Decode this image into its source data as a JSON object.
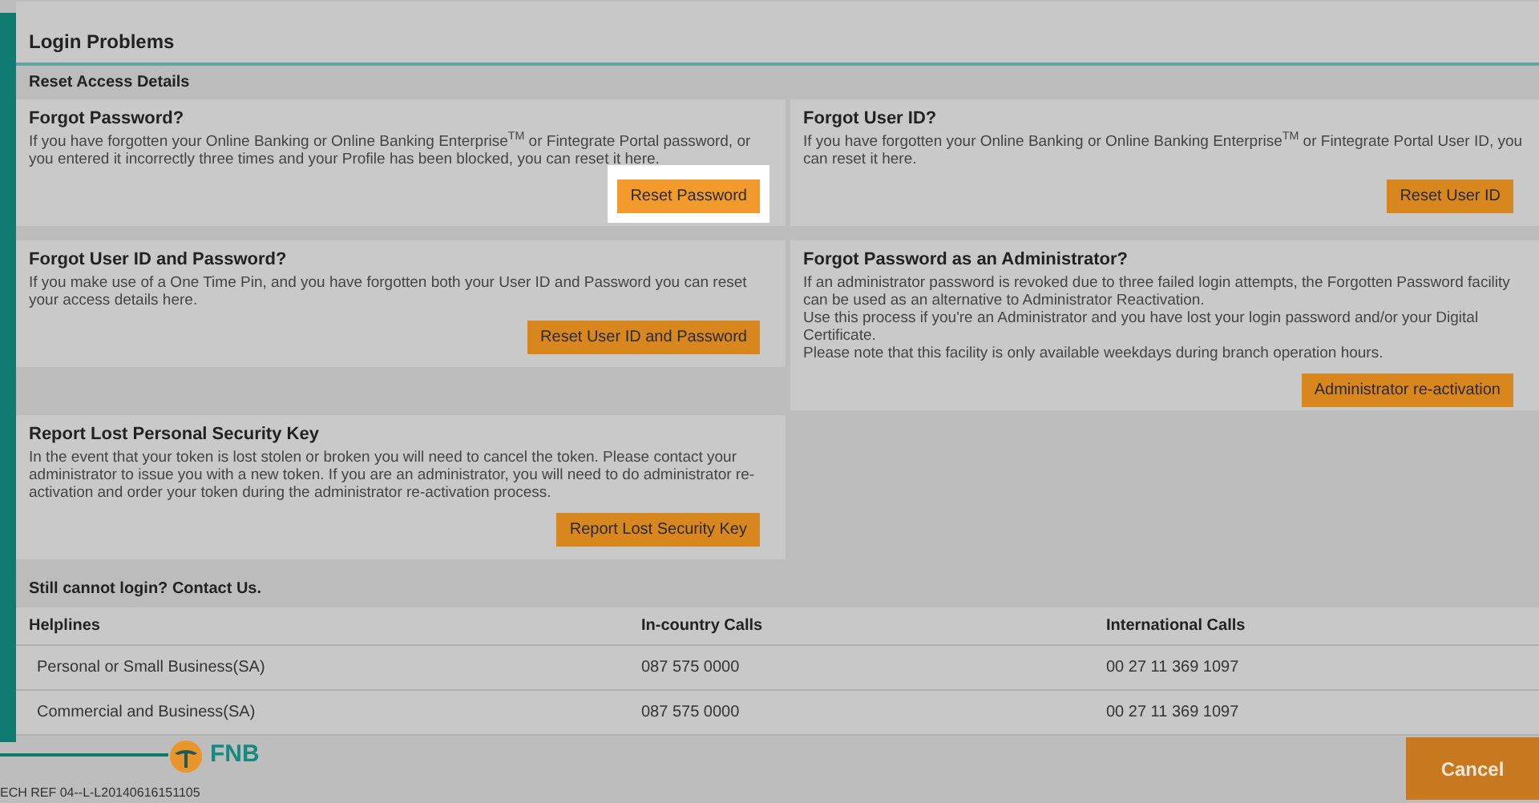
{
  "title": "Login Problems",
  "section": "Reset Access Details",
  "cards": [
    {
      "heading": "Forgot Password?",
      "body": [
        "If you have forgotten your Online Banking or Online Banking Enterprise$^{TM}$ or Fintegrate Portal password, or you entered it incorrectly three times and your Profile has been blocked, you can reset it here."
      ],
      "button": "Reset Password",
      "highlighted": true
    },
    {
      "heading": "Forgot User ID?",
      "body": [
        "If you have forgotten your Online Banking or Online Banking Enterprise$^{TM}$ or Fintegrate Portal User ID, you can reset it here."
      ],
      "button": "Reset User ID",
      "highlighted": false
    },
    {
      "heading": "Forgot User ID and Password?",
      "body": [
        "If you make use of a One Time Pin, and you have forgotten both your User ID and Password you can reset your access details here."
      ],
      "button": "Reset User ID and Password",
      "highlighted": false
    },
    {
      "heading": "Forgot Password as an Administrator?",
      "body": [
        "If an administrator password is revoked due to three failed login attempts, the Forgotten Password facility can be used as an alternative to Administrator Reactivation.",
        "Use this process if you're an Administrator and you have lost your login password and/or your Digital Certificate.",
        "Please note that this facility is only available weekdays during branch operation hours."
      ],
      "button": "Administrator re-activation",
      "highlighted": false
    },
    {
      "heading": "Report Lost Personal Security Key",
      "body": [
        "In the event that your token is lost stolen or broken you will need to cancel the token. Please contact your administrator to issue you with a new token. If you are an administrator, you will need to do administrator re-activation and order your token during the administrator re-activation process."
      ],
      "button": "Report Lost Security Key",
      "highlighted": false
    }
  ],
  "contact": {
    "heading": "Still cannot login? Contact Us.",
    "columns": [
      "Helplines",
      "In-country Calls",
      "International Calls"
    ],
    "rows": [
      [
        "Personal or Small Business(SA)",
        "087 575 0000",
        "00 27 11 369 1097"
      ],
      [
        "Commercial and Business(SA)",
        "087 575 0000",
        "00 27 11 369 1097"
      ]
    ]
  },
  "logo": "FNB",
  "reference": "ECH REF 04--L-L20140616151105",
  "cancel": "Cancel"
}
